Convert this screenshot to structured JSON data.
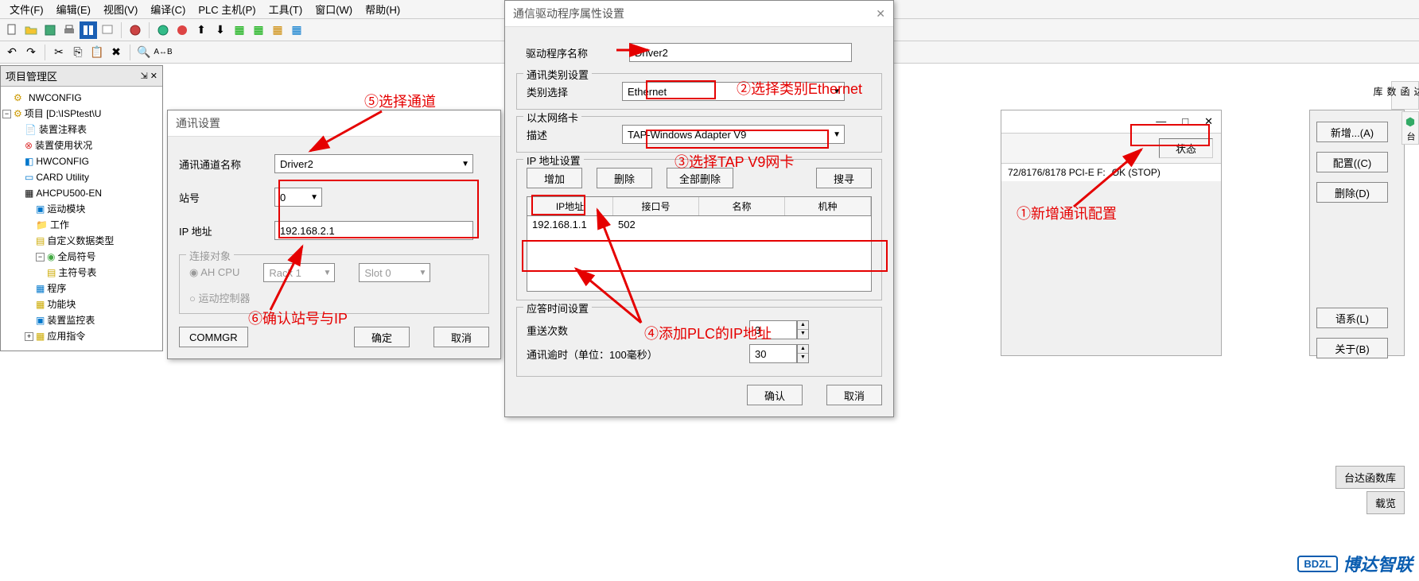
{
  "menubar": [
    "文件(F)",
    "编辑(E)",
    "视图(V)",
    "编译(C)",
    "PLC 主机(P)",
    "工具(T)",
    "窗口(W)",
    "帮助(H)"
  ],
  "tree": {
    "title": "项目管理区",
    "nwconfig": "NWCONFIG",
    "project": "项目 [D:\\ISPtest\\U",
    "items": [
      "装置注释表",
      "装置使用状况",
      "HWCONFIG",
      "CARD Utility",
      "AHCPU500-EN",
      "运动模块",
      "工作",
      "自定义数据类型",
      "全局符号",
      "主符号表",
      "程序",
      "功能块",
      "装置监控表",
      "应用指令"
    ]
  },
  "commDlg": {
    "title": "通讯设置",
    "channelLabel": "通讯通道名称",
    "channelValue": "Driver2",
    "stationLabel": "站号",
    "stationValue": "0",
    "ipLabel": "IP 地址",
    "ipValue": "192.168.2.1",
    "connGroup": "连接对象",
    "ahcpu": "AH CPU",
    "motion": "运动控制器",
    "rack": "Rack 1",
    "slot": "Slot 0",
    "commgr": "COMMGR",
    "ok": "确定",
    "cancel": "取消"
  },
  "driverDlg": {
    "title": "通信驱动程序属性设置",
    "nameLabel": "驱动程序名称",
    "nameValue": "Driver2",
    "catGroup": "通讯类别设置",
    "catLabel": "类别选择",
    "catValue": "Ethernet",
    "nicGroup": "以太网络卡",
    "nicLabel": "描述",
    "nicValue": "TAP-Windows Adapter V9",
    "ipGroup": "IP 地址设置",
    "btnAdd": "增加",
    "btnDel": "删除",
    "btnDelAll": "全部删除",
    "btnSearch": "搜寻",
    "tblHdr": [
      "IP地址",
      "接口号",
      "名称",
      "机种"
    ],
    "tblRow": [
      "192.168.1.1",
      "502",
      "",
      ""
    ],
    "timeGroup": "应答时间设置",
    "retryLabel": "重送次数",
    "retryValue": "3",
    "timeoutLabel": "通讯逾时（单位：100毫秒）",
    "timeoutValue": "30",
    "ok": "确认",
    "cancel": "取消"
  },
  "rightP": {
    "status": "状态",
    "device": "72/8176/8178 PCI-E F:",
    "ok": "OK (STOP)",
    "btnNew": "新增...(A)",
    "btnCfg": "配置((C)",
    "btnDel": "删除(D)",
    "btnLang": "语系(L)",
    "btnAbout": "关于(B)",
    "tdlib": "台达函数库",
    "tdlib2": "台达函数库",
    "zairu": "载览"
  },
  "annotations": {
    "a1": "①新增通讯配置",
    "a2": "②选择类别Ethernet",
    "a3": "③选择TAP V9网卡",
    "a4": "④添加PLC的IP地址",
    "a5": "⑤选择通道",
    "a6": "⑥确认站号与IP"
  },
  "logo": {
    "code": "BDZL",
    "text": "博达智联"
  }
}
